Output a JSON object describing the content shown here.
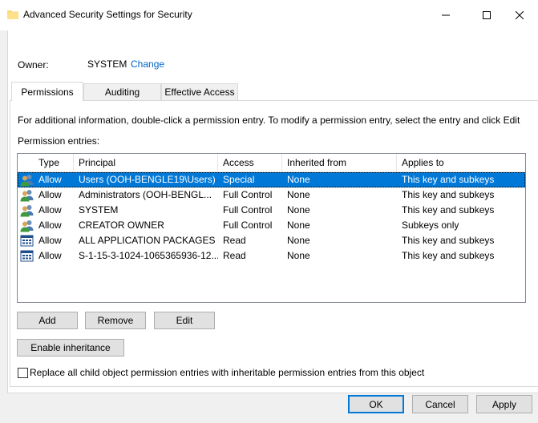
{
  "window": {
    "title": "Advanced Security Settings for Security"
  },
  "owner": {
    "label": "Owner:",
    "value": "SYSTEM",
    "change_link": "Change"
  },
  "tabs": [
    {
      "label": "Permissions",
      "active": true
    },
    {
      "label": "Auditing",
      "active": false
    },
    {
      "label": "Effective Access",
      "active": false
    }
  ],
  "info_text": "For additional information, double-click a permission entry. To modify a permission entry, select the entry and click Edit",
  "entries_label": "Permission entries:",
  "columns": [
    "Type",
    "Principal",
    "Access",
    "Inherited from",
    "Applies to"
  ],
  "rows": [
    {
      "type": "Allow",
      "principal": "Users (OOH-BENGLE19\\Users)",
      "access": "Special",
      "inherited": "None",
      "applies": "This key and subkeys",
      "icon": "users-group-icon",
      "selected": true
    },
    {
      "type": "Allow",
      "principal": "Administrators (OOH-BENGL...",
      "access": "Full Control",
      "inherited": "None",
      "applies": "This key and subkeys",
      "icon": "users-group-icon",
      "selected": false
    },
    {
      "type": "Allow",
      "principal": "SYSTEM",
      "access": "Full Control",
      "inherited": "None",
      "applies": "This key and subkeys",
      "icon": "users-group-icon",
      "selected": false
    },
    {
      "type": "Allow",
      "principal": "CREATOR OWNER",
      "access": "Full Control",
      "inherited": "None",
      "applies": "Subkeys only",
      "icon": "users-group-icon",
      "selected": false
    },
    {
      "type": "Allow",
      "principal": "ALL APPLICATION PACKAGES",
      "access": "Read",
      "inherited": "None",
      "applies": "This key and subkeys",
      "icon": "app-package-icon",
      "selected": false
    },
    {
      "type": "Allow",
      "principal": "S-1-15-3-1024-1065365936-12...",
      "access": "Read",
      "inherited": "None",
      "applies": "This key and subkeys",
      "icon": "app-package-icon",
      "selected": false
    }
  ],
  "buttons": {
    "add": "Add",
    "remove": "Remove",
    "edit": "Edit",
    "enable_inheritance": "Enable inheritance",
    "ok": "OK",
    "cancel": "Cancel",
    "apply": "Apply"
  },
  "replace_checkbox": {
    "label": "Replace all child object permission entries with inheritable permission entries from this object",
    "checked": false
  },
  "colors": {
    "selection": "#0078d7",
    "link": "#0066cc",
    "dialog_bg": "#f0f0f0"
  }
}
